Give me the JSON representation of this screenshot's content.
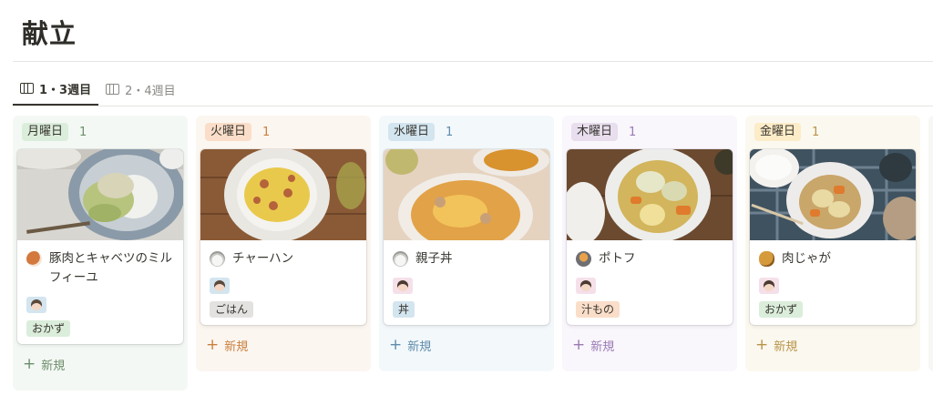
{
  "page": {
    "title": "献立"
  },
  "tabs": [
    {
      "label": "1・3週目",
      "active": true,
      "icon": "board-view-icon"
    },
    {
      "label": "2・4週目",
      "active": false,
      "icon": "board-view-icon"
    }
  ],
  "columns": [
    {
      "day": "月曜日",
      "count": "1",
      "new_label": "新規",
      "card": {
        "name": "豚肉とキャベツのミルフィーユ",
        "icon": "meat-on-bone-icon",
        "person": "boy-icon",
        "category": "おかず"
      }
    },
    {
      "day": "火曜日",
      "count": "1",
      "new_label": "新規",
      "card": {
        "name": "チャーハン",
        "icon": "rice-bowl-icon",
        "person": "boy-icon",
        "category": "ごはん"
      }
    },
    {
      "day": "水曜日",
      "count": "1",
      "new_label": "新規",
      "card": {
        "name": "親子丼",
        "icon": "rice-bowl-icon",
        "person": "girl-icon",
        "category": "丼"
      }
    },
    {
      "day": "木曜日",
      "count": "1",
      "new_label": "新規",
      "card": {
        "name": "ポトフ",
        "icon": "stew-pot-icon",
        "person": "girl-icon",
        "category": "汁もの"
      }
    },
    {
      "day": "金曜日",
      "count": "1",
      "new_label": "新規",
      "card": {
        "name": "肉じゃが",
        "icon": "potato-icon",
        "person": "girl-icon",
        "category": "おかず"
      }
    }
  ],
  "colors": {
    "category_tag_okazu": "#dbeddb",
    "category_tag_gohan": "#e3e2e0",
    "category_tag_don": "#d3e5ef",
    "category_tag_shirumono": "#fadec9",
    "person_tag_boy": "#d3e5ef",
    "person_tag_girl": "#f5e0e9"
  }
}
